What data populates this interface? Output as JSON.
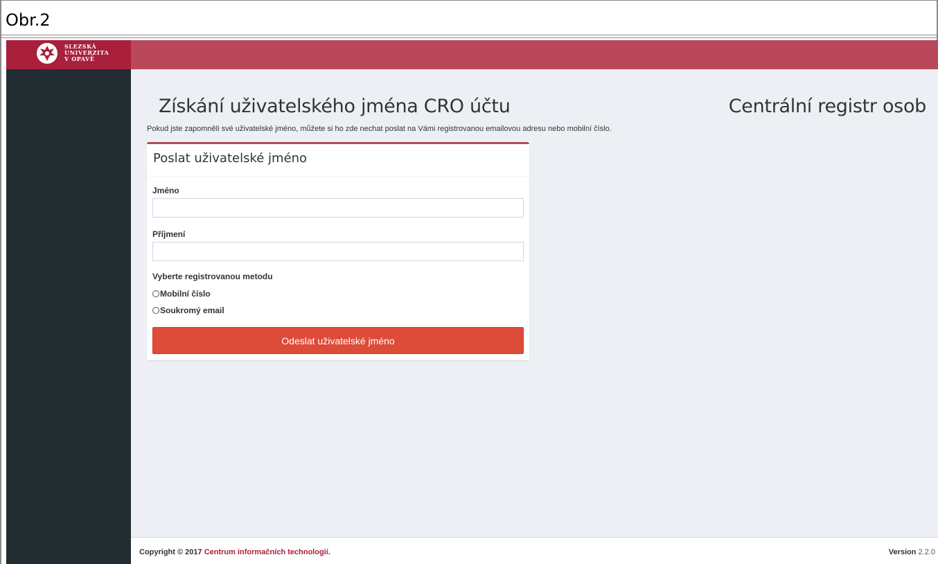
{
  "figure": {
    "caption": "Obr.2"
  },
  "brand": {
    "logo_lines": [
      "SLEZSKÁ",
      "UNIVERZITA",
      "V OPAVĚ"
    ],
    "logo_icon": "university-emblem-icon",
    "accent_color": "#b9485b",
    "logo_bg_color": "#a91f3c",
    "sidebar_color": "#222d32"
  },
  "page": {
    "title": "Získání uživatelského jména CRO účtu",
    "app_name": "Centrální registr osob",
    "description": "Pokud jste zapomněli své uživatelské jméno, můžete si ho zde nechat poslat na Vámi registrovanou emailovou adresu nebo mobilní číslo."
  },
  "form": {
    "title": "Poslat uživatelské jméno",
    "first_name_label": "Jméno",
    "first_name_value": "",
    "last_name_label": "Příjmení",
    "last_name_value": "",
    "method_label": "Vyberte registrovanou metodu",
    "method_options": [
      "Mobilní číslo",
      "Soukromý email"
    ],
    "submit_label": "Odeslat uživatelské jméno",
    "submit_color": "#dd4b39"
  },
  "footer": {
    "copyright_prefix": "Copyright © 2017",
    "copyright_link": "Centrum informačních technologií",
    "copyright_suffix": ".",
    "version_label": "Version",
    "version_value": "2.2.0"
  }
}
